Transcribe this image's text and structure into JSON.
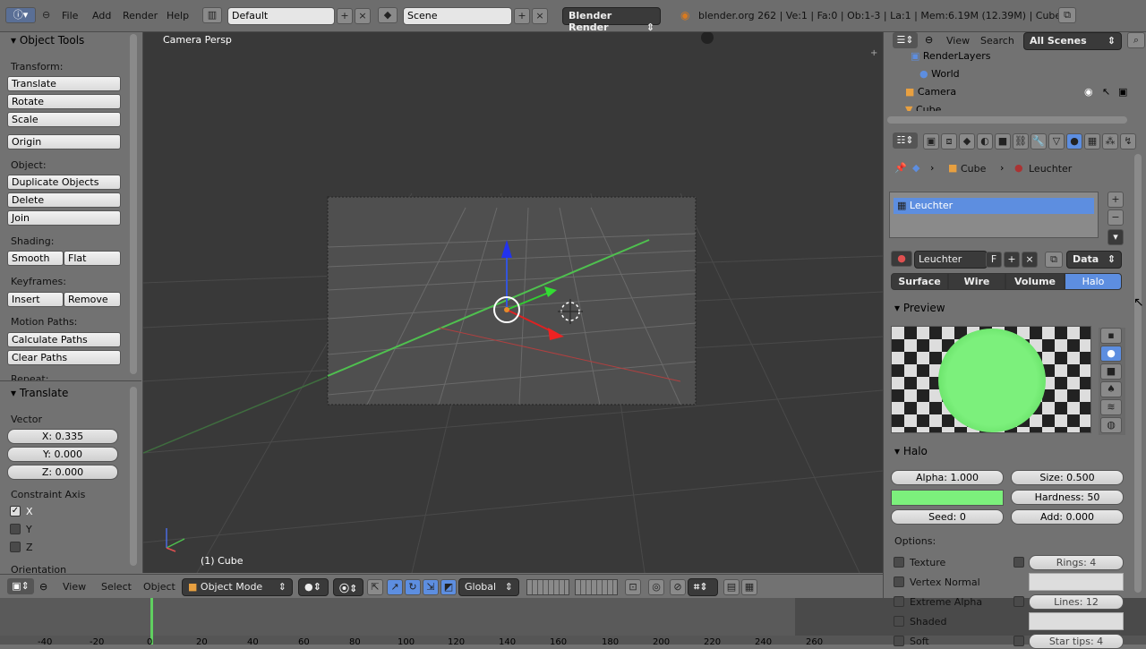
{
  "topbar": {
    "menus": [
      "File",
      "Add",
      "Render",
      "Help"
    ],
    "screen_layout": "Default",
    "scene": "Scene",
    "render_engine": "Blender Render",
    "stats": "blender.org 262 | Ve:1 | Fa:0 | Ob:1-3 | La:1 | Mem:6.19M (12.39M) | Cube"
  },
  "toolshelf": {
    "title": "Object Tools",
    "transform_label": "Transform:",
    "translate": "Translate",
    "rotate": "Rotate",
    "scale": "Scale",
    "origin": "Origin",
    "object_label": "Object:",
    "duplicate": "Duplicate Objects",
    "delete": "Delete",
    "join": "Join",
    "shading_label": "Shading:",
    "smooth": "Smooth",
    "flat": "Flat",
    "keyframes_label": "Keyframes:",
    "insert": "Insert",
    "remove": "Remove",
    "motion_label": "Motion Paths:",
    "calc_paths": "Calculate Paths",
    "clear_paths": "Clear Paths",
    "repeat_label": "Repeat:",
    "op_title": "Translate",
    "vector_label": "Vector",
    "x": "X: 0.335",
    "y": "Y: 0.000",
    "z": "Z: 0.000",
    "constraint_label": "Constraint Axis",
    "ax_x": "X",
    "ax_y": "Y",
    "ax_z": "Z",
    "orientation_label": "Orientation"
  },
  "viewport": {
    "view_name": "Camera Persp",
    "object_name": "(1) Cube"
  },
  "vpheader": {
    "view": "View",
    "select": "Select",
    "object": "Object",
    "mode": "Object Mode",
    "orientation": "Global"
  },
  "timeline": {
    "ticks": [
      "-40",
      "-20",
      "0",
      "20",
      "40",
      "60",
      "80",
      "100",
      "120",
      "140",
      "160",
      "180",
      "200",
      "220",
      "240",
      "260"
    ]
  },
  "outliner": {
    "view": "View",
    "search": "Search",
    "filter": "All Scenes",
    "items": [
      "RenderLayers",
      "World",
      "Camera",
      "Cube"
    ]
  },
  "props": {
    "breadcrumb_object": "Cube",
    "breadcrumb_material": "Leuchter",
    "slot_name": "Leuchter",
    "material_name": "Leuchter",
    "fake_user": "F",
    "link": "Data",
    "tabs": [
      "Surface",
      "Wire",
      "Volume",
      "Halo"
    ],
    "preview_title": "Preview",
    "halo_title": "Halo",
    "alpha": "Alpha: 1.000",
    "size": "Size: 0.500",
    "hardness": "Hardness: 50",
    "seed": "Seed: 0",
    "add": "Add: 0.000",
    "options_label": "Options:",
    "opt_texture": "Texture",
    "opt_vertex_normal": "Vertex Normal",
    "opt_extreme_alpha": "Extreme Alpha",
    "opt_shaded": "Shaded",
    "opt_soft": "Soft",
    "rings": "Rings: 4",
    "lines": "Lines: 12",
    "star_tips": "Star tips: 4",
    "halo_color": "#7cf07c",
    "active_tab_color": "#5d8ee0"
  }
}
